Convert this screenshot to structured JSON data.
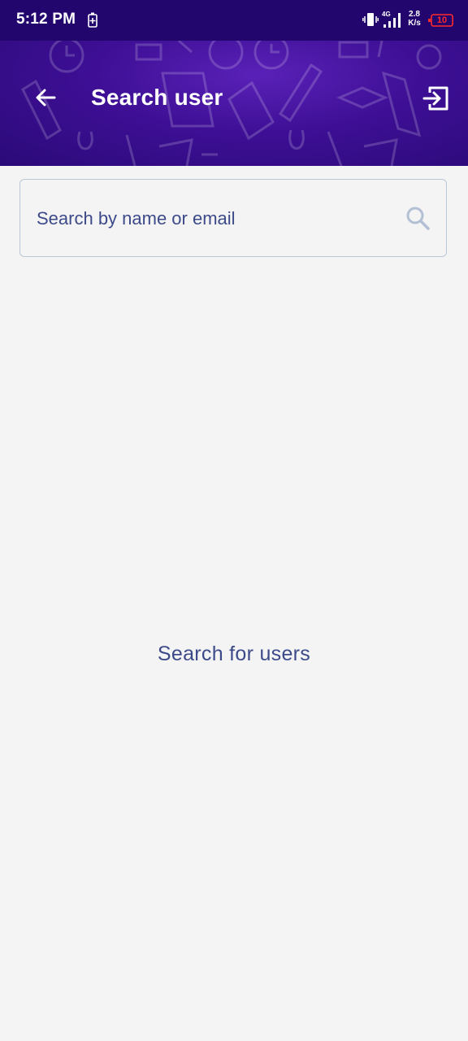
{
  "status_bar": {
    "time": "5:12 PM",
    "network_type": "4G",
    "net_speed_value": "2.8",
    "net_speed_unit": "K/s",
    "battery_level": "10",
    "icons": [
      "battery-saver-icon",
      "vibrate-icon",
      "signal-icon",
      "battery-icon"
    ]
  },
  "app_bar": {
    "title": "Search user",
    "back_icon": "arrow-left-icon",
    "logout_icon": "logout-icon"
  },
  "search": {
    "placeholder": "Search by name or email",
    "value": "",
    "icon": "search-icon"
  },
  "main": {
    "empty_message": "Search for users"
  },
  "colors": {
    "header_primary": "#3e0f95",
    "status_bar": "#22066e",
    "text_accent": "#3d4a8a",
    "background": "#f4f4f4",
    "battery_low": "#ff2a2a"
  }
}
